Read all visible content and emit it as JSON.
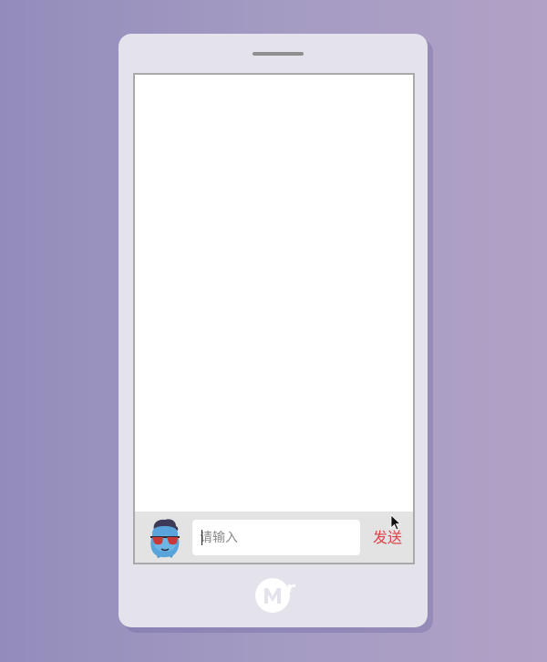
{
  "phone": {
    "screen": {
      "messages": []
    },
    "input_bar": {
      "avatar_icon": "cartoon-avatar-with-sunglasses",
      "input": {
        "value": "",
        "placeholder": "请输入"
      },
      "send_label": "发送"
    },
    "home_button_icon": "mr-logo-icon"
  },
  "colors": {
    "send_text": "#e0414b",
    "input_bar_bg": "#e3e3e3",
    "phone_body": "#e4e3ec"
  }
}
